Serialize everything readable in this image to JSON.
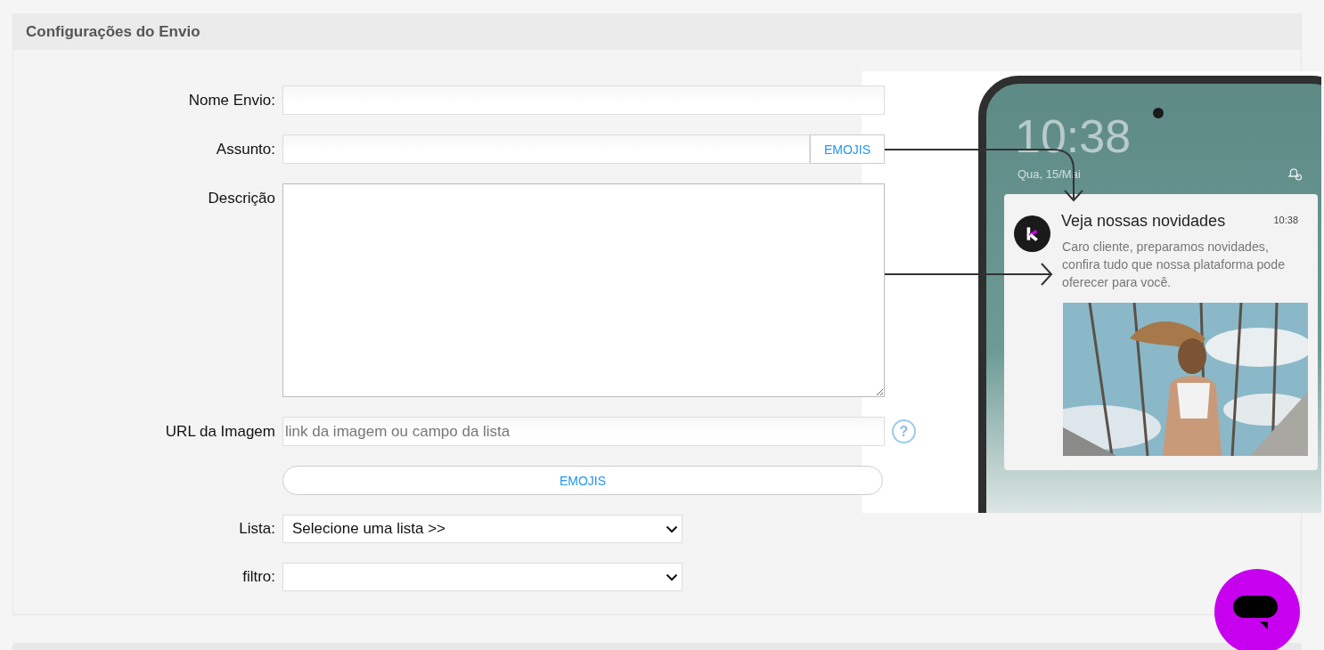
{
  "section": {
    "title": "Configurações do Envio"
  },
  "fields": [
    {
      "kind": "text",
      "label": "Nome Envio:"
    },
    {
      "kind": "text_emoji",
      "label": "Assunto:",
      "button": "EMOJIS"
    },
    {
      "kind": "textarea",
      "label": "Descrição"
    },
    {
      "kind": "text_help",
      "label": "URL da Imagem",
      "placeholder": "link da imagem ou campo da lista",
      "help": "?"
    },
    {
      "kind": "button",
      "button": "EMOJIS"
    },
    {
      "kind": "select",
      "label": "Lista:",
      "value": "Selecione uma lista >>"
    },
    {
      "kind": "select",
      "label": "filtro:"
    }
  ],
  "preview": {
    "clock": "10:38",
    "date": "Qua, 15/Mai",
    "notification": {
      "title": "Veja nossas novidades",
      "time": "10:38",
      "body": "Caro cliente, preparamos novidades, confira tudo que nossa plataforma pode oferecer para você."
    }
  }
}
